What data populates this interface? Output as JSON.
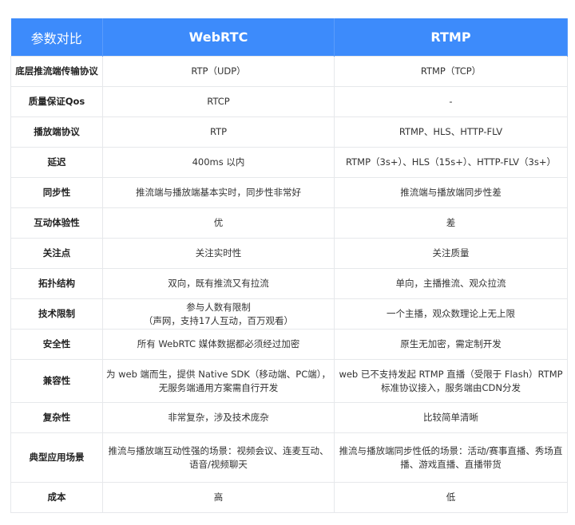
{
  "header": [
    "参数对比",
    "WebRTC",
    "RTMP"
  ],
  "rows": [
    [
      "底层推流端传输协议",
      "RTP（UDP）",
      "RTMP（TCP）"
    ],
    [
      "质量保证Qos",
      "RTCP",
      "-"
    ],
    [
      "播放端协议",
      "RTP",
      "RTMP、HLS、HTTP-FLV"
    ],
    [
      "延迟",
      "400ms 以内",
      "RTMP（3s+）、HLS（15s+）、HTTP-FLV（3s+）"
    ],
    [
      "同步性",
      "推流端与播放端基本实时，同步性非常好",
      "推流端与播放端同步性差"
    ],
    [
      "互动体验性",
      "优",
      "差"
    ],
    [
      "关注点",
      "关注实时性",
      "关注质量"
    ],
    [
      "拓扑结构",
      "双向，既有推流又有拉流",
      "单向，主播推流、观众拉流"
    ],
    [
      "技术限制",
      "参与人数有限制\n（声网，支持17人互动，百万观看）",
      "一个主播，观众数理论上无上限"
    ],
    [
      "安全性",
      "所有 WebRTC 媒体数据都必须经过加密",
      "原生无加密，需定制开发"
    ],
    [
      "兼容性",
      "为 web 端而生，提供 Native SDK（移动端、PC端），无服务端通用方案需自行开发",
      "web 已不支持发起 RTMP 直播（受限于 Flash）RTMP 标准协议接入，服务端由CDN分发"
    ],
    [
      "复杂性",
      "非常复杂，涉及技术庞杂",
      "比较简单清晰"
    ],
    [
      "典型应用场景",
      "推流与播放端互动性强的场景：视频会议、连麦互动、语音/视频聊天",
      "推流与播放端同步性低的场景：活动/赛事直播、秀场直播、游戏直播、直播带货"
    ],
    [
      "成本",
      "高",
      "低"
    ]
  ]
}
